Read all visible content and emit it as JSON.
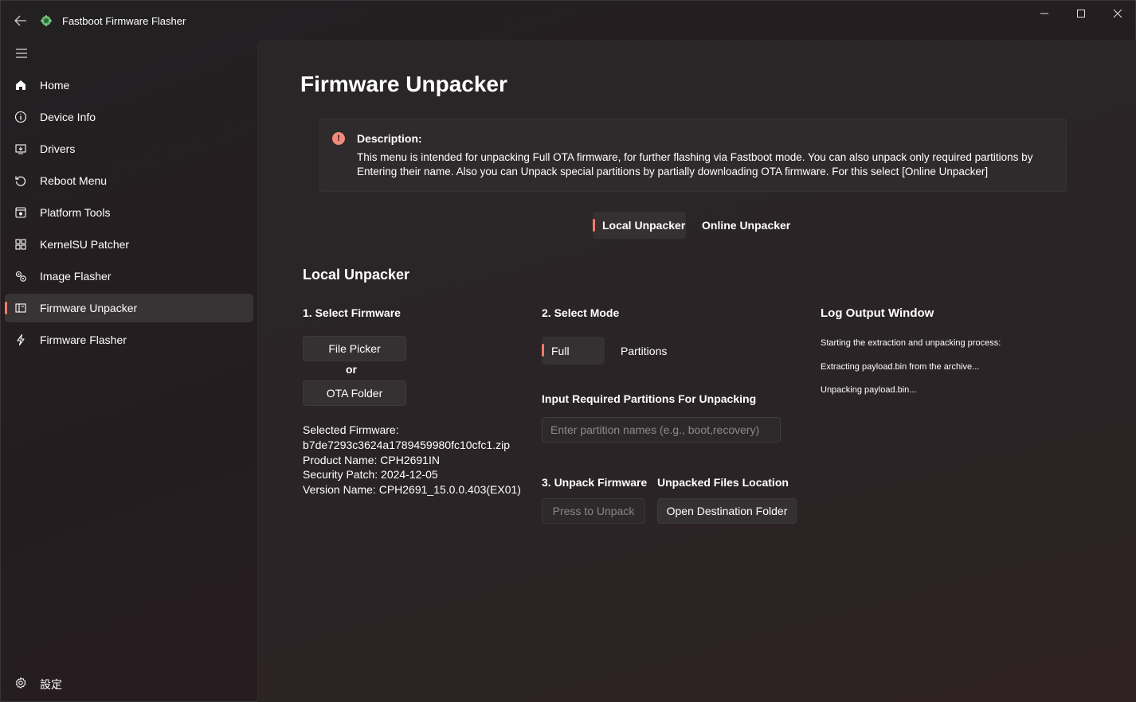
{
  "app": {
    "title": "Fastboot Firmware Flasher"
  },
  "colors": {
    "accent": "#f27a6b",
    "info_icon": "#f28b7b"
  },
  "sidebar": {
    "items": [
      {
        "label": "Home",
        "icon": "home-icon"
      },
      {
        "label": "Device Info",
        "icon": "info-icon"
      },
      {
        "label": "Drivers",
        "icon": "drivers-icon"
      },
      {
        "label": "Reboot Menu",
        "icon": "reboot-icon"
      },
      {
        "label": "Platform Tools",
        "icon": "platform-tools-icon"
      },
      {
        "label": "KernelSU Patcher",
        "icon": "grid-icon"
      },
      {
        "label": "Image Flasher",
        "icon": "gears-icon"
      },
      {
        "label": "Firmware Unpacker",
        "icon": "unpacker-icon",
        "active": true
      },
      {
        "label": "Firmware Flasher",
        "icon": "flash-icon"
      }
    ],
    "settings_label": "設定"
  },
  "page": {
    "title": "Firmware Unpacker",
    "description_title": "Description:",
    "description": "This menu is intended for unpacking Full OTA firmware, for further flashing via Fastboot mode. You can also unpack only required partitions by Entering their name. Also you can Unpack special partitions by partially downloading OTA firmware. For this select [Online Unpacker]",
    "tabs": [
      "Local Unpacker",
      "Online Unpacker"
    ],
    "selected_tab": "Local Unpacker"
  },
  "local": {
    "heading": "Local Unpacker",
    "step1": "1. Select Firmware",
    "file_picker": "File Picker",
    "or": "or",
    "ota_folder": "OTA Folder",
    "fw_info": [
      "Selected Firmware:",
      "b7de7293c3624a1789459980fc10cfc1.zip",
      "Product Name: CPH2691IN",
      "Security Patch: 2024-12-05",
      "Version Name: CPH2691_15.0.0.403(EX01)"
    ],
    "step2": "2. Select Mode",
    "mode_full": "Full",
    "mode_partitions": "Partitions",
    "selected_mode": "Full",
    "partitions_label": "Input Required Partitions For Unpacking",
    "partitions_placeholder": "Enter partition names (e.g., boot,recovery)",
    "partitions_value": "",
    "step3": "3. Unpack Firmware",
    "unpack_button": "Press to Unpack",
    "location_label": "Unpacked Files Location",
    "open_folder_button": "Open Destination Folder"
  },
  "log": {
    "title": "Log Output Window",
    "lines": [
      "Starting the extraction and unpacking process:",
      "Extracting payload.bin from the archive...",
      "Unpacking payload.bin..."
    ]
  }
}
